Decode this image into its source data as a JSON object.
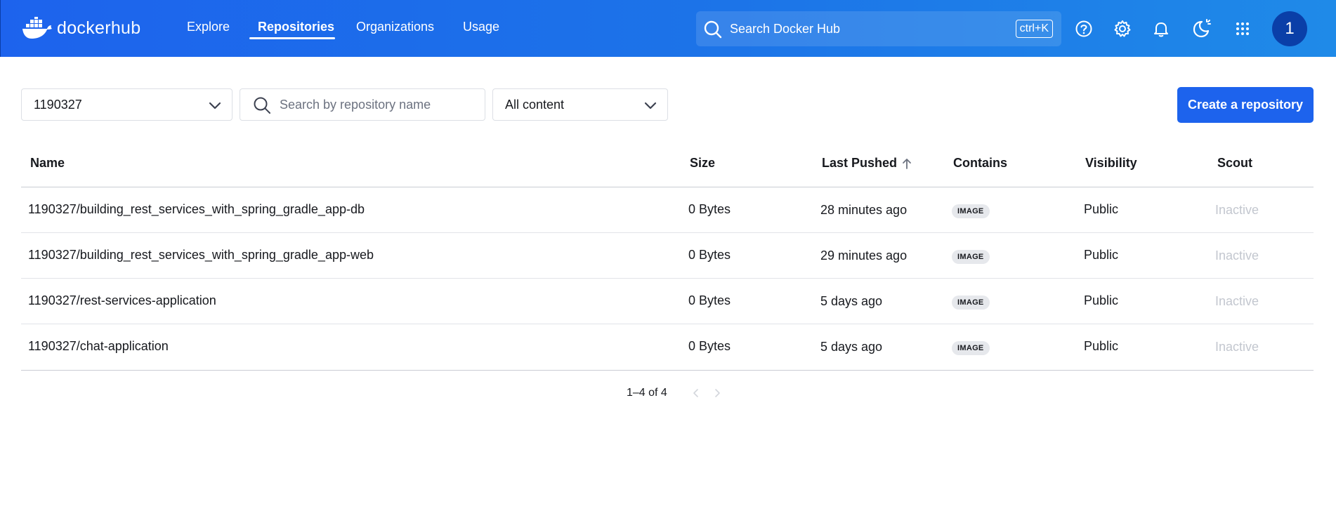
{
  "header": {
    "logo_word1": "docker",
    "logo_word2": "hub",
    "nav": [
      {
        "label": "Explore"
      },
      {
        "label": "Repositories"
      },
      {
        "label": "Organizations"
      },
      {
        "label": "Usage"
      }
    ],
    "active_nav": "Repositories",
    "search_placeholder": "Search Docker Hub",
    "search_shortcut": "ctrl+K",
    "avatar_initial": "1",
    "colors": {
      "primary": "#1d63ed",
      "avatar": "#0a3fa8"
    }
  },
  "toolbar": {
    "namespace_value": "1190327",
    "search_placeholder": "Search by repository name",
    "content_filter_value": "All content",
    "create_button_label": "Create a repository"
  },
  "table": {
    "columns": {
      "name": "Name",
      "size": "Size",
      "last_pushed": "Last Pushed",
      "contains": "Contains",
      "visibility": "Visibility",
      "scout": "Scout"
    },
    "rows": [
      {
        "name": "1190327/building_rest_services_with_spring_gradle_app-db",
        "size": "0 Bytes",
        "last_pushed": "28 minutes ago",
        "contains": "IMAGE",
        "visibility": "Public",
        "scout": "Inactive"
      },
      {
        "name": "1190327/building_rest_services_with_spring_gradle_app-web",
        "size": "0 Bytes",
        "last_pushed": "29 minutes ago",
        "contains": "IMAGE",
        "visibility": "Public",
        "scout": "Inactive"
      },
      {
        "name": "1190327/rest-services-application",
        "size": "0 Bytes",
        "last_pushed": "5 days ago",
        "contains": "IMAGE",
        "visibility": "Public",
        "scout": "Inactive"
      },
      {
        "name": "1190327/chat-application",
        "size": "0 Bytes",
        "last_pushed": "5 days ago",
        "contains": "IMAGE",
        "visibility": "Public",
        "scout": "Inactive"
      }
    ]
  },
  "pagination": {
    "text": "1–4 of 4"
  }
}
